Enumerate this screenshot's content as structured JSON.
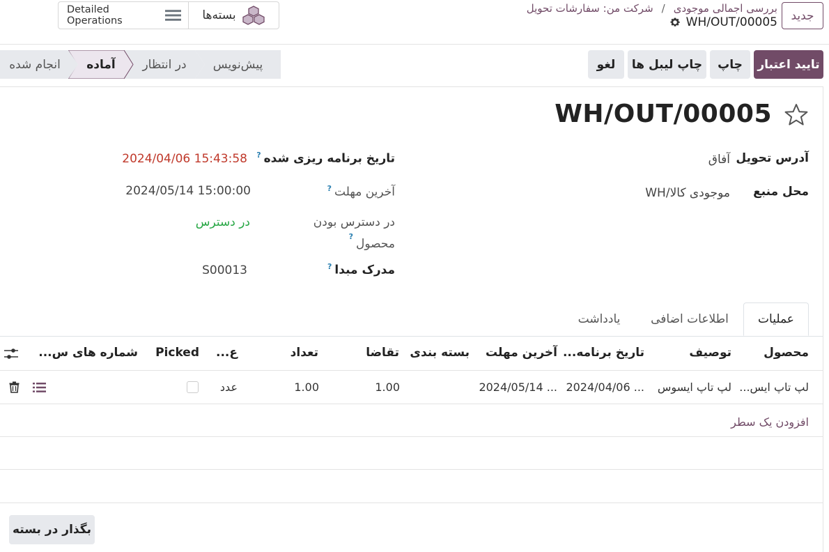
{
  "header": {
    "new_button": "جدید",
    "breadcrumb": [
      "بررسی اجمالی موجودی",
      "شرکت من: سفارشات تحویل"
    ],
    "current_record": "WH/OUT/00005",
    "view_switch": {
      "detailed_label": "Detailed Operations",
      "packages_label": "بسته‌ها"
    }
  },
  "actions": {
    "validate": "تایید اعتبار",
    "print": "چاپ",
    "print_labels": "چاپ لیبل ها",
    "cancel": "لغو"
  },
  "statusbar": {
    "stages": [
      "پیش‌نویس",
      "در انتظار",
      "آماده",
      "انجام شده"
    ],
    "active": "آماده"
  },
  "record": {
    "title": "WH/OUT/00005",
    "fields": {
      "delivery_address_label": "آدرس تحویل",
      "delivery_address_value": "آفاق",
      "source_location_label": "محل منبع",
      "source_location_value": "WH/موجودی کالا",
      "scheduled_date_label": "تاریخ برنامه ریزی شده",
      "scheduled_date_value": "2024/04/06 15:43:58",
      "deadline_label": "آخرین مهلت",
      "deadline_value": "2024/05/14 15:00:00",
      "availability_label_1": "در دسترس بودن",
      "availability_label_2": "محصول",
      "availability_value": "در دسترس",
      "source_document_label": "مدرک مبدا",
      "source_document_value": "S00013"
    }
  },
  "tabs": [
    "عملیات",
    "اطلاعات اضافی",
    "یادداشت"
  ],
  "table": {
    "headers": {
      "product": "محصول",
      "description": "توصیف",
      "scheduled": "تاریخ برنامه...",
      "deadline": "آخرین مهلت",
      "packaging": "بسته بندی",
      "demand": "تقاضا",
      "quantity": "تعداد",
      "uom": "ع...",
      "picked": "Picked",
      "serials": "شماره های س..."
    },
    "rows": [
      {
        "product": "لپ تاپ ایس...",
        "description": "لپ تاپ ایسوس",
        "scheduled": "2024/04/06 ...",
        "deadline": "2024/05/14 ...",
        "packaging": "",
        "demand": "1.00",
        "quantity": "1.00",
        "uom": "عدد",
        "picked": false
      }
    ],
    "add_line": "افزودن یک سطر"
  },
  "footer": {
    "put_in_pack": "بگذار در بسته"
  },
  "colors": {
    "accent": "#714b67",
    "deadline_red": "#c0392b",
    "available_green": "#28a745"
  }
}
